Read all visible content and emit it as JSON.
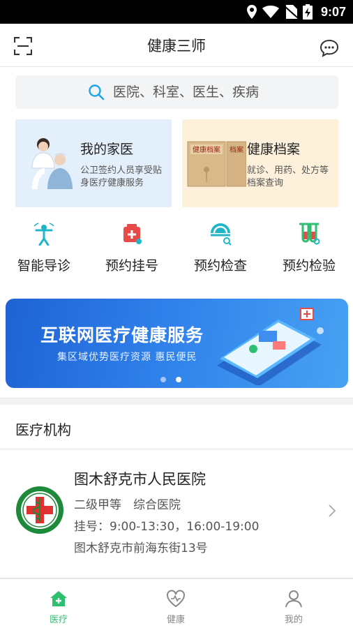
{
  "status_bar": {
    "time": "9:07"
  },
  "header": {
    "title": "健康三师"
  },
  "search": {
    "placeholder": "医院、科室、医生、疾病"
  },
  "cards": [
    {
      "title": "我的家医",
      "desc": "公卫签约人员享受贴身医疗健康服务"
    },
    {
      "title": "健康档案",
      "desc": "就诊、用药、处方等档案查询"
    }
  ],
  "quick_services": [
    {
      "label": "智能导诊",
      "icon": "smart-guide-icon"
    },
    {
      "label": "预约挂号",
      "icon": "registration-icon"
    },
    {
      "label": "预约检查",
      "icon": "exam-icon"
    },
    {
      "label": "预约检验",
      "icon": "lab-test-icon"
    }
  ],
  "banner": {
    "title": "互联网医疗健康服务",
    "subtitle": "集区域优势医疗资源 惠民便民",
    "active_slide": 2,
    "slide_count": 2
  },
  "section": {
    "title": "医疗机构"
  },
  "hospitals": [
    {
      "name": "图木舒克市人民医院",
      "level": "二级甲等　综合医院",
      "hours": "挂号：9:00-13:30，16:00-19:00",
      "address": "图木舒克市前海东街13号"
    }
  ],
  "bottom_nav": [
    {
      "label": "医疗",
      "active": true
    },
    {
      "label": "健康",
      "active": false
    },
    {
      "label": "我的",
      "active": false
    }
  ],
  "colors": {
    "accent": "#2fbf71",
    "brand_blue": "#2f80ea",
    "icon_red": "#e84a4a",
    "icon_teal": "#1fb6c8"
  }
}
